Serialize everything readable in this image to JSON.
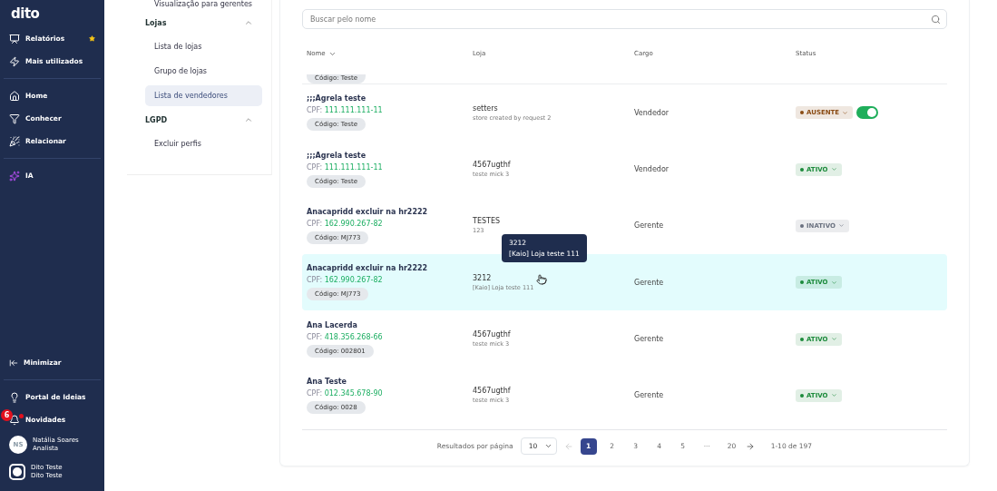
{
  "sidebar": {
    "logo": "dito",
    "items": [
      {
        "label": "Relatórios",
        "starred": true
      },
      {
        "label": "Mais utilizados",
        "starred": false
      },
      {
        "label": "Home",
        "starred": false
      },
      {
        "label": "Conhecer",
        "starred": false
      },
      {
        "label": "Relacionar",
        "starred": false
      },
      {
        "label": "IA",
        "starred": false
      }
    ],
    "minimize": "Minimizar",
    "portal": "Portal de Ideias",
    "news": {
      "label": "Novidades",
      "badge": "6"
    },
    "user": {
      "initials": "NS",
      "name": "Natália Soares",
      "role": "Analista"
    },
    "account": {
      "name": "Dito Teste",
      "sub": "Dito Teste"
    }
  },
  "submenu": {
    "cut_item": "Visualização para gerentes",
    "sections": [
      {
        "title": "Lojas",
        "expanded": true,
        "items": [
          {
            "label": "Lista de lojas",
            "selected": false
          },
          {
            "label": "Grupo de lojas",
            "selected": false
          },
          {
            "label": "Lista de vendedores",
            "selected": true
          }
        ]
      },
      {
        "title": "LGPD",
        "expanded": true,
        "items": [
          {
            "label": "Excluir perfis",
            "selected": false
          }
        ]
      }
    ]
  },
  "search": {
    "placeholder": "Buscar pelo nome"
  },
  "table": {
    "columns": [
      "Nome",
      "Loja",
      "Cargo",
      "Status"
    ],
    "partial_row_code": "Código: Teste",
    "rows": [
      {
        "name": ";;;Agrela teste",
        "cpf_label": "CPF:",
        "cpf": "111.111.111-11",
        "code": "Código: Teste",
        "store": "setters",
        "store_sub": "store created by request 2",
        "role": "Vendedor",
        "status": {
          "label": "AUSENTE",
          "color": "#8a4b14"
        },
        "toggle": true,
        "hovered": false
      },
      {
        "name": ";;;Agrela teste",
        "cpf_label": "CPF:",
        "cpf": "111.111.111-11",
        "code": "Código: Teste",
        "store": "4567ugthf",
        "store_sub": "teste mick 3",
        "role": "Vendedor",
        "status": {
          "label": "ATIVO",
          "color": "#1b8a3a"
        },
        "hovered": false
      },
      {
        "name": "Anacapridd excluir na hr2222",
        "cpf_label": "CPF:",
        "cpf": "162.990.267-82",
        "code": "Código: MJ773",
        "store": "TESTES",
        "store_sub": "123",
        "role": "Gerente",
        "status": {
          "label": "INATIVO",
          "color": "#6b7280"
        },
        "hovered": false
      },
      {
        "name": "Anacapridd excluir na hr2222",
        "cpf_label": "CPF:",
        "cpf": "162.990.267-82",
        "code": "Código: MJ773",
        "store": "3212",
        "store_sub": "[Kaio] Loja teste 111",
        "role": "Gerente",
        "status": {
          "label": "ATIVO",
          "color": "#1b8a3a"
        },
        "hovered": true,
        "tooltip": [
          "3212",
          "[Kaio] Loja teste 111"
        ]
      },
      {
        "name": "Ana Lacerda",
        "cpf_label": "CPF:",
        "cpf": "418.356.268-66",
        "code": "Código: 002801",
        "store": "4567ugthf",
        "store_sub": "teste mick 3",
        "role": "Gerente",
        "status": {
          "label": "ATIVO",
          "color": "#1b8a3a"
        },
        "hovered": false
      },
      {
        "name": "Ana Teste",
        "cpf_label": "CPF:",
        "cpf": "012.345.678-90",
        "code": "Código: 0028",
        "store": "4567ugthf",
        "store_sub": "teste mick 3",
        "role": "Gerente",
        "status": {
          "label": "ATIVO",
          "color": "#1b8a3a"
        },
        "hovered": false
      }
    ]
  },
  "pagination": {
    "per_page_label": "Resultados por página",
    "per_page": "10",
    "pages": [
      {
        "label": "1",
        "selected": true
      },
      {
        "label": "2",
        "selected": false
      },
      {
        "label": "3",
        "selected": false
      },
      {
        "label": "4",
        "selected": false
      },
      {
        "label": "5",
        "selected": false
      },
      {
        "label": "···",
        "selected": false
      },
      {
        "label": "20",
        "selected": false
      }
    ],
    "range": "1-10 de 197"
  }
}
